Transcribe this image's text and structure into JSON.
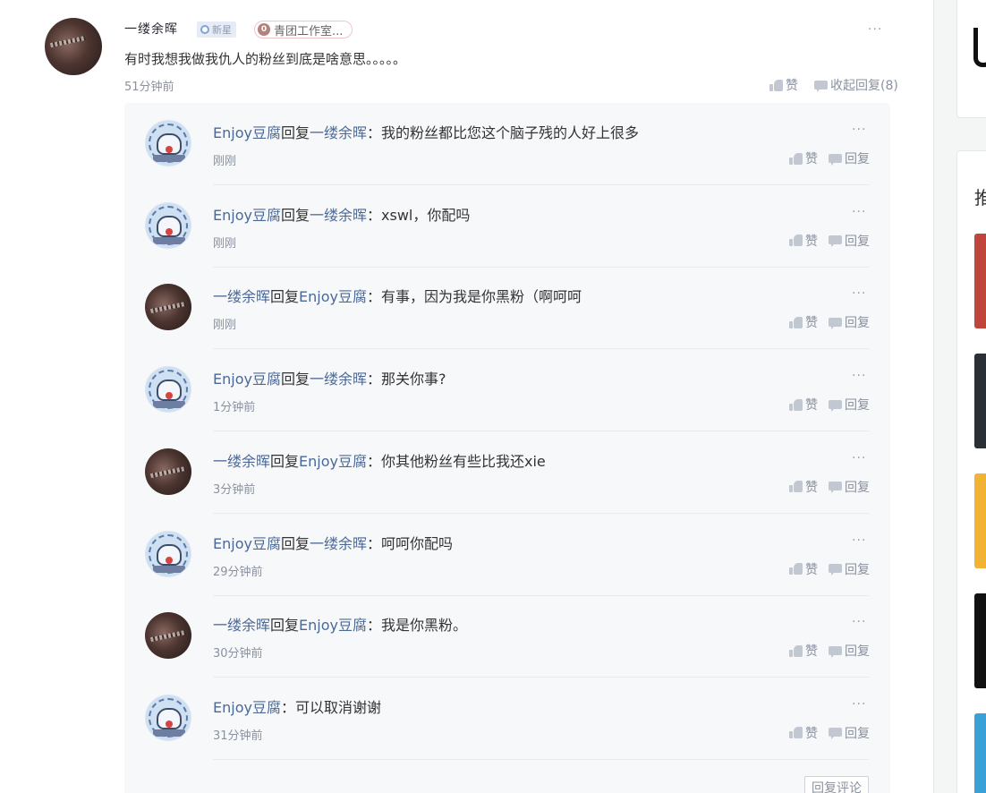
{
  "comment": {
    "author": "一缕余晖",
    "level_badge": "新星",
    "group_badge_num": "0",
    "group_badge": "青团工作室...",
    "text": "有时我想我做我仇人的粉丝到底是啥意思。。。。。",
    "time": "51分钟前",
    "like_label": "赞",
    "collapse_label": "收起回复(8)",
    "more_label": "···"
  },
  "replies": [
    {
      "user": "Enjoy豆腐",
      "reply_word": "回复",
      "target": "一缕余晖",
      "colon": "：",
      "text": "我的粉丝都比您这个脑子残的人好上很多",
      "time": "刚刚",
      "like": "赞",
      "reply": "回复",
      "more": "···"
    },
    {
      "user": "Enjoy豆腐",
      "reply_word": "回复",
      "target": "一缕余晖",
      "colon": "：",
      "text": "xswl，你配吗",
      "time": "刚刚",
      "like": "赞",
      "reply": "回复",
      "more": "···"
    },
    {
      "user": "一缕余晖",
      "reply_word": "回复",
      "target": "Enjoy豆腐",
      "colon": "：",
      "text": "有事，因为我是你黑粉（啊呵呵",
      "time": "刚刚",
      "like": "赞",
      "reply": "回复",
      "more": "···"
    },
    {
      "user": "Enjoy豆腐",
      "reply_word": "回复",
      "target": "一缕余晖",
      "colon": "：",
      "text": "那关你事?",
      "time": "1分钟前",
      "like": "赞",
      "reply": "回复",
      "more": "···"
    },
    {
      "user": "一缕余晖",
      "reply_word": "回复",
      "target": "Enjoy豆腐",
      "colon": "：",
      "text": "你其他粉丝有些比我还xie",
      "time": "3分钟前",
      "like": "赞",
      "reply": "回复",
      "more": "···"
    },
    {
      "user": "Enjoy豆腐",
      "reply_word": "回复",
      "target": "一缕余晖",
      "colon": "：",
      "text": "呵呵你配吗",
      "time": "29分钟前",
      "like": "赞",
      "reply": "回复",
      "more": "···"
    },
    {
      "user": "一缕余晖",
      "reply_word": "回复",
      "target": "Enjoy豆腐",
      "colon": "：",
      "text": "我是你黑粉。",
      "time": "30分钟前",
      "like": "赞",
      "reply": "回复",
      "more": "···"
    },
    {
      "user": "Enjoy豆腐",
      "reply_word": "",
      "target": "",
      "colon": "：",
      "text": "可以取消谢谢",
      "time": "31分钟前",
      "like": "赞",
      "reply": "回复",
      "more": "···"
    }
  ],
  "reply_comment_button": "回复评论",
  "sidebar": {
    "heading_partial": "推",
    "thumb_colors": [
      "#c0453c",
      "#2b2f36",
      "#f2b233",
      "#111111",
      "#3aa0d8"
    ]
  }
}
